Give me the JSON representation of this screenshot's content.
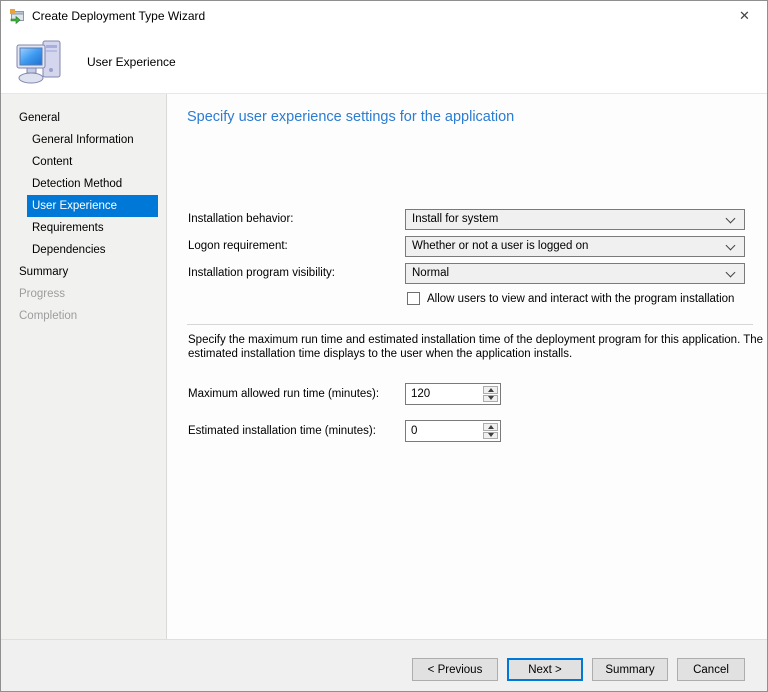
{
  "window": {
    "title": "Create Deployment Type Wizard",
    "close_glyph": "✕"
  },
  "header": {
    "title": "User Experience"
  },
  "sidebar": {
    "items": [
      {
        "label": "General",
        "level": 0,
        "state": "normal"
      },
      {
        "label": "General Information",
        "level": 1,
        "state": "normal"
      },
      {
        "label": "Content",
        "level": 1,
        "state": "normal"
      },
      {
        "label": "Detection Method",
        "level": 1,
        "state": "normal"
      },
      {
        "label": "User Experience",
        "level": 1,
        "state": "selected"
      },
      {
        "label": "Requirements",
        "level": 1,
        "state": "normal"
      },
      {
        "label": "Dependencies",
        "level": 1,
        "state": "normal"
      },
      {
        "label": "Summary",
        "level": 0,
        "state": "normal"
      },
      {
        "label": "Progress",
        "level": 0,
        "state": "disabled"
      },
      {
        "label": "Completion",
        "level": 0,
        "state": "disabled"
      }
    ]
  },
  "content": {
    "heading": "Specify user experience settings for the application",
    "fields": [
      {
        "label": "Installation behavior:",
        "value": "Install for system"
      },
      {
        "label": "Logon requirement:",
        "value": "Whether or not a user is logged on"
      },
      {
        "label": "Installation program visibility:",
        "value": "Normal"
      }
    ],
    "checkbox": {
      "label": "Allow users to view and interact with the program installation",
      "checked": false
    },
    "description": "Specify the maximum run time and estimated installation time of the deployment program for this application. The estimated installation time displays to the user when the application installs.",
    "spinners": [
      {
        "label": "Maximum allowed run time (minutes):",
        "value": "120"
      },
      {
        "label": "Estimated installation time (minutes):",
        "value": "0"
      }
    ]
  },
  "footer": {
    "buttons": [
      {
        "label": "< Previous",
        "default": false
      },
      {
        "label": "Next >",
        "default": true
      },
      {
        "label": "Summary",
        "default": false
      },
      {
        "label": "Cancel",
        "default": false
      }
    ]
  },
  "colors": {
    "accent": "#0078d7",
    "heading": "#2b7cd3",
    "sidebar_bg": "#f1f1f0",
    "footer_bg": "#f0f0f0"
  }
}
